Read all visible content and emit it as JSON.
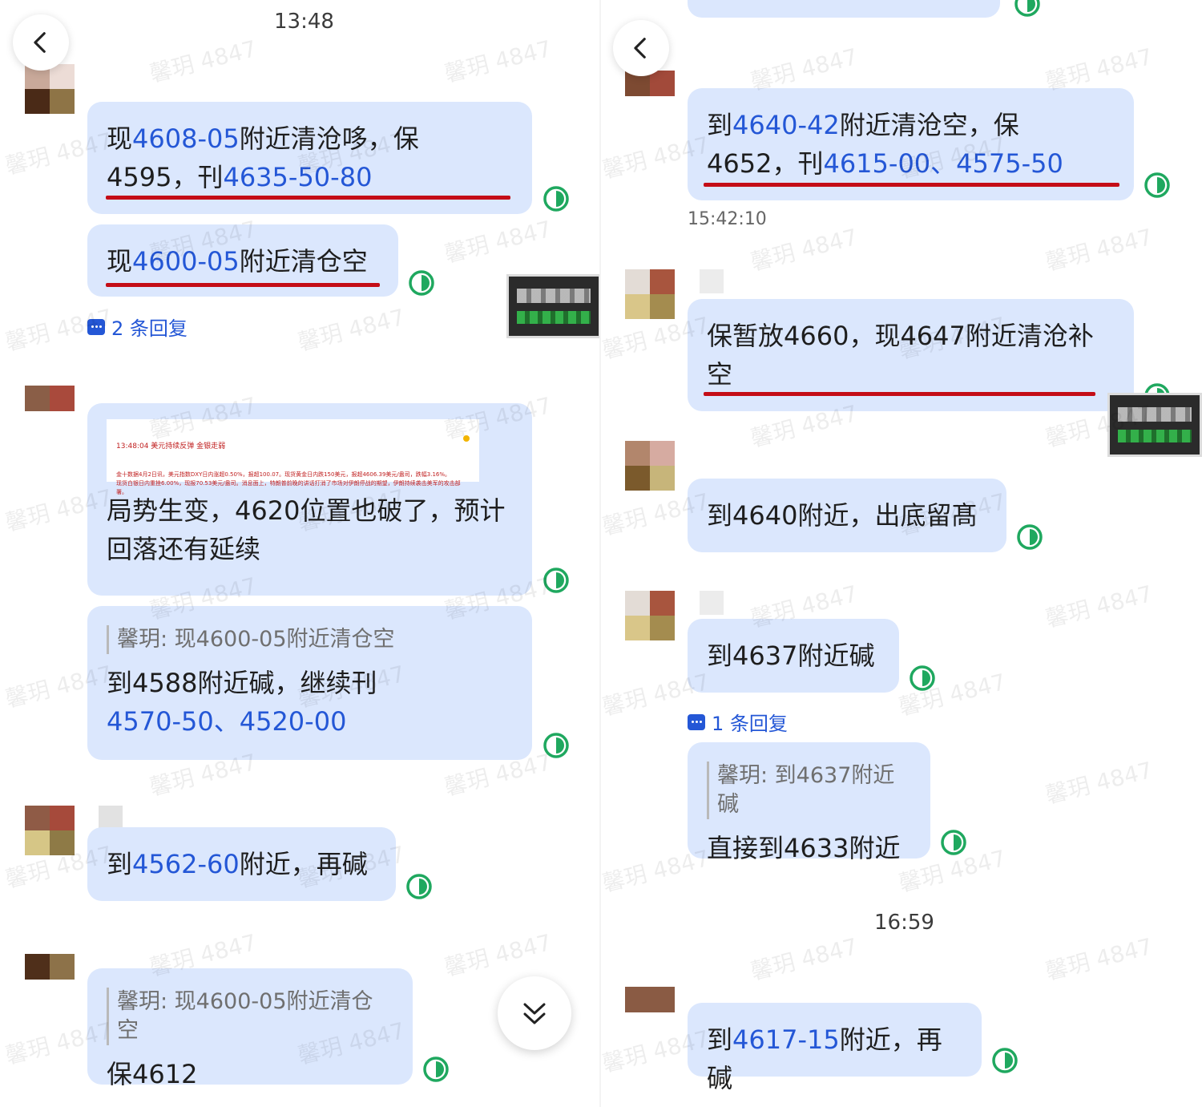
{
  "colors": {
    "bubble": "#dbe7fd",
    "number": "#2457d6",
    "underline": "#c40d17",
    "read_icon": "#1fa85f"
  },
  "watermark": "馨玥 4847",
  "left": {
    "time_header": "13:48",
    "messages": [
      {
        "parts": [
          "现",
          "4608-05",
          "附近清沧哆，保",
          "4595，刊",
          "4635-50-80"
        ]
      },
      {
        "parts": [
          "现",
          "4600-05",
          "附近清仓空"
        ]
      },
      {
        "reply_count": "2 条回复"
      },
      {
        "card_title": "13:48:04  美元持续反弹 金银走弱",
        "card_lines": [
          "金十数据4月2日讯，美元指数DXY日内涨超0.50%，报超100.07。现货黄金日内跌150美元，报超4606.39美元/盎司，跌幅3.16%。",
          "现货白银日内重挫6.00%，现报70.53美元/盎司。消息面上，特朗普前晚的讲话打消了市场对伊朗停战的期望，伊朗持续袭击美军的攻击部署。"
        ],
        "line1": "局势生变，4620位置也破了，预计",
        "line2": "回落还有延续"
      },
      {
        "quote": "馨玥: 现4600-05附近清仓空",
        "parts": [
          "到4588附近碱，继续刊",
          "4570-50",
          "、",
          "4520-00"
        ]
      },
      {
        "parts": [
          "到",
          "4562-60",
          "附近，再碱"
        ]
      },
      {
        "quote": "馨玥: 现4600-05附近清仓空",
        "text": "保4612"
      }
    ]
  },
  "right": {
    "time_mid": "15:42:10",
    "time_footer": "16:59",
    "messages": [
      {
        "parts": [
          "到",
          "4640-42",
          "附近清沧空，保",
          "4652，刊",
          "4615-00",
          "、",
          "4575-50"
        ]
      },
      {
        "line1": "保暂放4660，现4647附近清沧补",
        "line2": "空"
      },
      {
        "text": "到4640附近，出底留髙"
      },
      {
        "text": "到4637附近碱"
      },
      {
        "reply_count": "1 条回复"
      },
      {
        "quote": "馨玥: 到4637附近碱",
        "text": "直接到4633附近"
      },
      {
        "parts": [
          "到",
          "4617-15",
          "附近，再碱"
        ]
      }
    ]
  }
}
